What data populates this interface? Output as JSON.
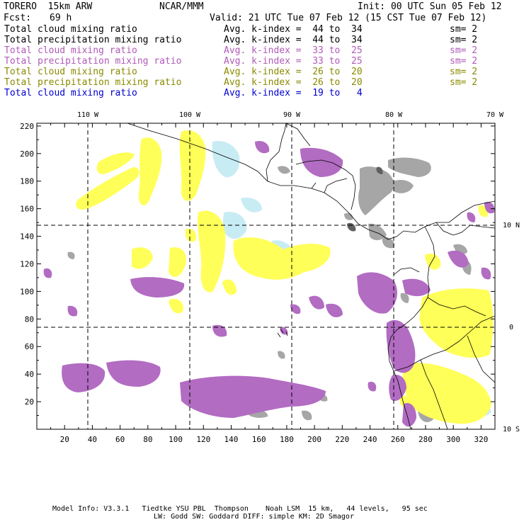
{
  "header": {
    "model_name": "TORERO  15km ARW",
    "org": "NCAR/MMM",
    "init": "Init: 00 UTC Sun 05 Feb 12",
    "fcst_label": "Fcst:",
    "fcst_value": "69 h",
    "valid": "Valid: 21 UTC Tue 07 Feb 12 (15 CST Tue 07 Feb 12)"
  },
  "legend": [
    {
      "field": "Total cloud mixing ratio",
      "kindex": "Avg. k-index =  44 to  34",
      "sm": "sm= 2",
      "color": "#000000"
    },
    {
      "field": "Total precipitation mixing ratio",
      "kindex": "Avg. k-index =  44 to  34",
      "sm": "sm= 2",
      "color": "#000000"
    },
    {
      "field": "Total cloud mixing ratio",
      "kindex": "Avg. k-index =  33 to  25",
      "sm": "sm= 2",
      "color": "#b05ab8"
    },
    {
      "field": "Total precipitation mixing ratio",
      "kindex": "Avg. k-index =  33 to  25",
      "sm": "sm= 2",
      "color": "#b05ab8"
    },
    {
      "field": "Total cloud mixing ratio",
      "kindex": "Avg. k-index =  26 to  20",
      "sm": "sm= 2",
      "color": "#8a8a00"
    },
    {
      "field": "Total precipitation mixing ratio",
      "kindex": "Avg. k-index =  26 to  20",
      "sm": "sm= 2",
      "color": "#8a8a00"
    },
    {
      "field": "Total cloud mixing ratio",
      "kindex": "Avg. k-index =  19 to   4",
      "sm": "",
      "color": "#0000d0"
    }
  ],
  "map": {
    "top_longitude_labels": [
      "110 W",
      "100 W",
      "90 W",
      "80 W",
      "70 W"
    ],
    "right_latitude_labels": [
      "10 N",
      "0",
      "10 S"
    ],
    "y_axis_labels": [
      "220",
      "200",
      "180",
      "160",
      "140",
      "120",
      "100",
      "80",
      "60",
      "40",
      "20"
    ],
    "x_axis_labels": [
      "20",
      "40",
      "60",
      "80",
      "100",
      "120",
      "140",
      "160",
      "180",
      "200",
      "220",
      "240",
      "260",
      "280",
      "300",
      "320"
    ],
    "colors": {
      "purple": "#b26cc2",
      "yellow": "#ffff59",
      "light_blue": "#c8ecf4",
      "gray": "#a6a6a6",
      "dark_gray": "#606060"
    }
  },
  "footer": {
    "line1": "Model Info: V3.3.1   Tiedtke YSU PBL  Thompson    Noah LSM  15 km,   44 levels,   95 sec",
    "line2": "LW: Godd SW: Goddard DIFF: simple KM: 2D Smagor"
  }
}
